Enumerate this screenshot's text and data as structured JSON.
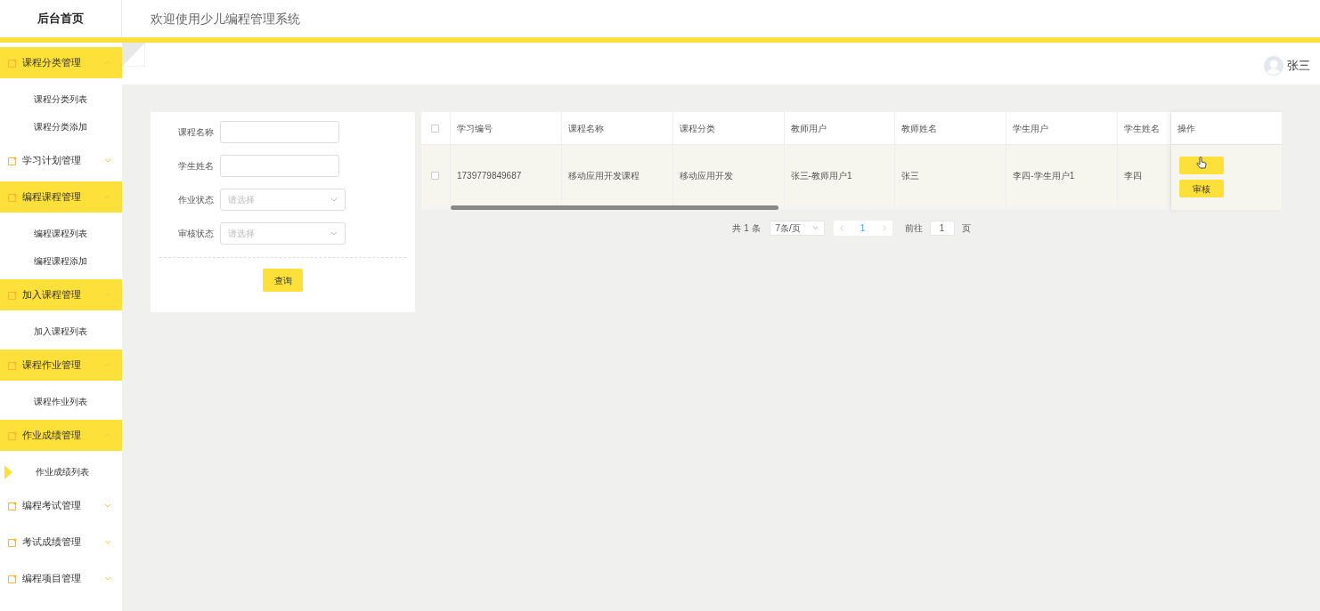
{
  "header": {
    "title": "后台首页",
    "welcome": "欢迎使用少儿编程管理系统"
  },
  "user": {
    "name": "张三"
  },
  "sidebar": {
    "groups": [
      {
        "label": "课程分类管理",
        "expanded": true,
        "children": [
          {
            "label": "课程分类列表",
            "selected": false
          },
          {
            "label": "课程分类添加",
            "selected": false
          }
        ]
      },
      {
        "label": "学习计划管理",
        "expanded": false
      },
      {
        "label": "编程课程管理",
        "expanded": true,
        "children": [
          {
            "label": "编程课程列表",
            "selected": false
          },
          {
            "label": "编程课程添加",
            "selected": false
          }
        ]
      },
      {
        "label": "加入课程管理",
        "expanded": true,
        "children": [
          {
            "label": "加入课程列表",
            "selected": false
          }
        ]
      },
      {
        "label": "课程作业管理",
        "expanded": true,
        "children": [
          {
            "label": "课程作业列表",
            "selected": false
          }
        ]
      },
      {
        "label": "作业成绩管理",
        "expanded": true,
        "children": [
          {
            "label": "作业成绩列表",
            "selected": true
          }
        ]
      },
      {
        "label": "编程考试管理",
        "expanded": false
      },
      {
        "label": "考试成绩管理",
        "expanded": false
      },
      {
        "label": "编程项目管理",
        "expanded": false
      }
    ]
  },
  "search_form": {
    "fields": [
      {
        "kind": "text",
        "label": "课程名称"
      },
      {
        "kind": "text",
        "label": "学生姓名"
      },
      {
        "kind": "select",
        "label": "作业状态",
        "placeholder": "请选择"
      },
      {
        "kind": "select",
        "label": "审核状态",
        "placeholder": "请选择"
      }
    ],
    "button": "查询"
  },
  "table": {
    "columns": [
      "学习编号",
      "课程名称",
      "课程分类",
      "教师用户",
      "教师姓名",
      "学生用户",
      "学生姓名",
      "操作"
    ],
    "rows": [
      {
        "checked": false,
        "cells": [
          "1739779849687",
          "移动应用开发课程",
          "移动应用开发",
          "张三-教师用户1",
          "张三",
          "李四-学生用户1",
          "李四"
        ],
        "actions": [
          {
            "kind": "covered"
          },
          {
            "kind": "text",
            "label": "审核"
          }
        ]
      }
    ],
    "header_checked": false
  },
  "pagination": {
    "total": "共 1 条",
    "page_size": "7条/页",
    "pages": [
      {
        "label": "1",
        "selected": true
      }
    ],
    "goto_label": "前往",
    "goto_value": "1",
    "goto_suffix": "页"
  }
}
